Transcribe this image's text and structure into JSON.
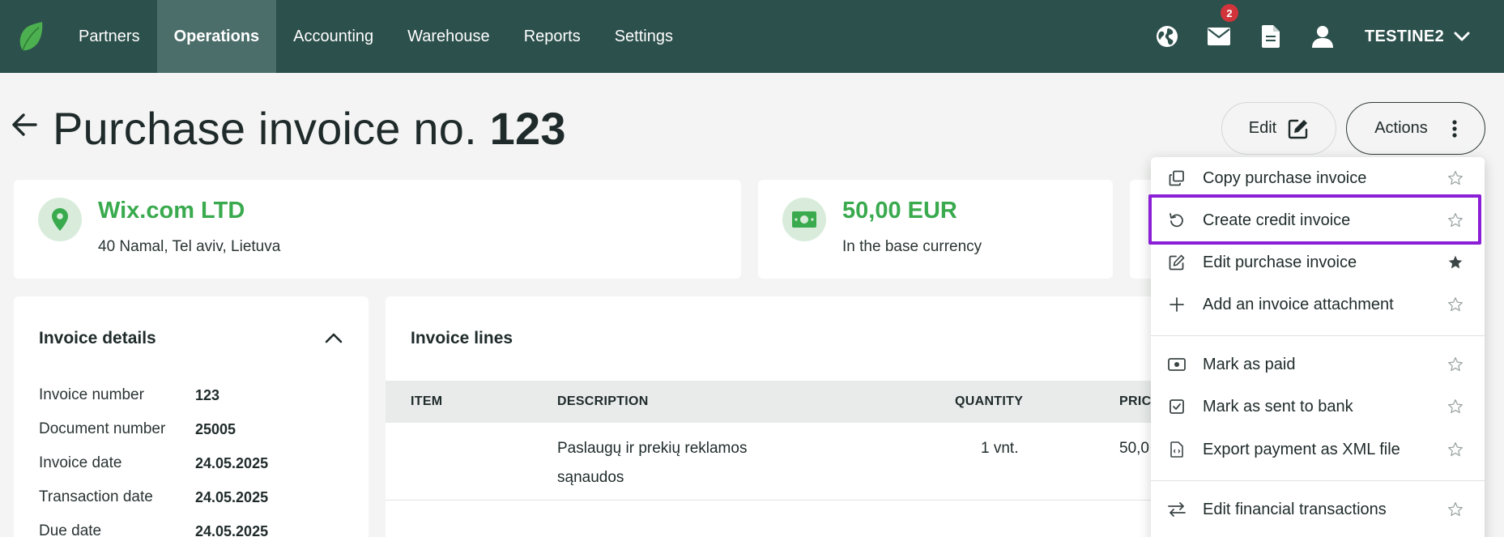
{
  "nav": {
    "items": [
      {
        "label": "Partners",
        "active": false
      },
      {
        "label": "Operations",
        "active": true
      },
      {
        "label": "Accounting",
        "active": false
      },
      {
        "label": "Warehouse",
        "active": false
      },
      {
        "label": "Reports",
        "active": false
      },
      {
        "label": "Settings",
        "active": false
      }
    ],
    "messages_badge": "2",
    "user_name": "TESTINE2"
  },
  "page": {
    "title_prefix": "Purchase invoice no. ",
    "title_number": "123",
    "edit_label": "Edit",
    "actions_label": "Actions"
  },
  "partner_card": {
    "name": "Wix.com LTD",
    "address": "40 Namal, Tel aviv, Lietuva"
  },
  "amount_card": {
    "amount": "50,00 EUR",
    "note": "In the base currency"
  },
  "invoice_details": {
    "title": "Invoice details",
    "rows": [
      {
        "label": "Invoice number",
        "value": "123"
      },
      {
        "label": "Document number",
        "value": "25005"
      },
      {
        "label": "Invoice date",
        "value": "24.05.2025"
      },
      {
        "label": "Transaction date",
        "value": "24.05.2025"
      },
      {
        "label": "Due date",
        "value": "24.05.2025"
      }
    ]
  },
  "invoice_lines": {
    "title": "Invoice lines",
    "columns": [
      "ITEM",
      "DESCRIPTION",
      "QUANTITY",
      "PRIC"
    ],
    "rows": [
      {
        "item": "",
        "description_line1": "Paslaugų ir prekių reklamos",
        "description_line2": "sąnaudos",
        "quantity": "1 vnt.",
        "price": "50,0"
      }
    ]
  },
  "actions_menu": {
    "items": [
      {
        "label": "Copy purchase invoice",
        "icon": "copy-icon",
        "starred": false
      },
      {
        "label": "Create credit invoice",
        "icon": "undo-icon",
        "starred": false,
        "highlighted": true
      },
      {
        "label": "Edit purchase invoice",
        "icon": "edit-icon",
        "starred": true
      },
      {
        "label": "Add an invoice attachment",
        "icon": "plus-icon",
        "starred": false
      },
      {
        "label": "Mark as paid",
        "icon": "cash-icon",
        "starred": false
      },
      {
        "label": "Mark as sent to bank",
        "icon": "checkbox-icon",
        "starred": false
      },
      {
        "label": "Export payment as XML file",
        "icon": "xml-file-icon",
        "starred": false
      },
      {
        "label": "Edit financial transactions",
        "icon": "swap-icon",
        "starred": false
      }
    ]
  },
  "colors": {
    "topbar": "#2c504c",
    "active_tab": "#4b6e6a",
    "accent_green": "#3aaa4e",
    "highlight": "#8b1fd6"
  }
}
